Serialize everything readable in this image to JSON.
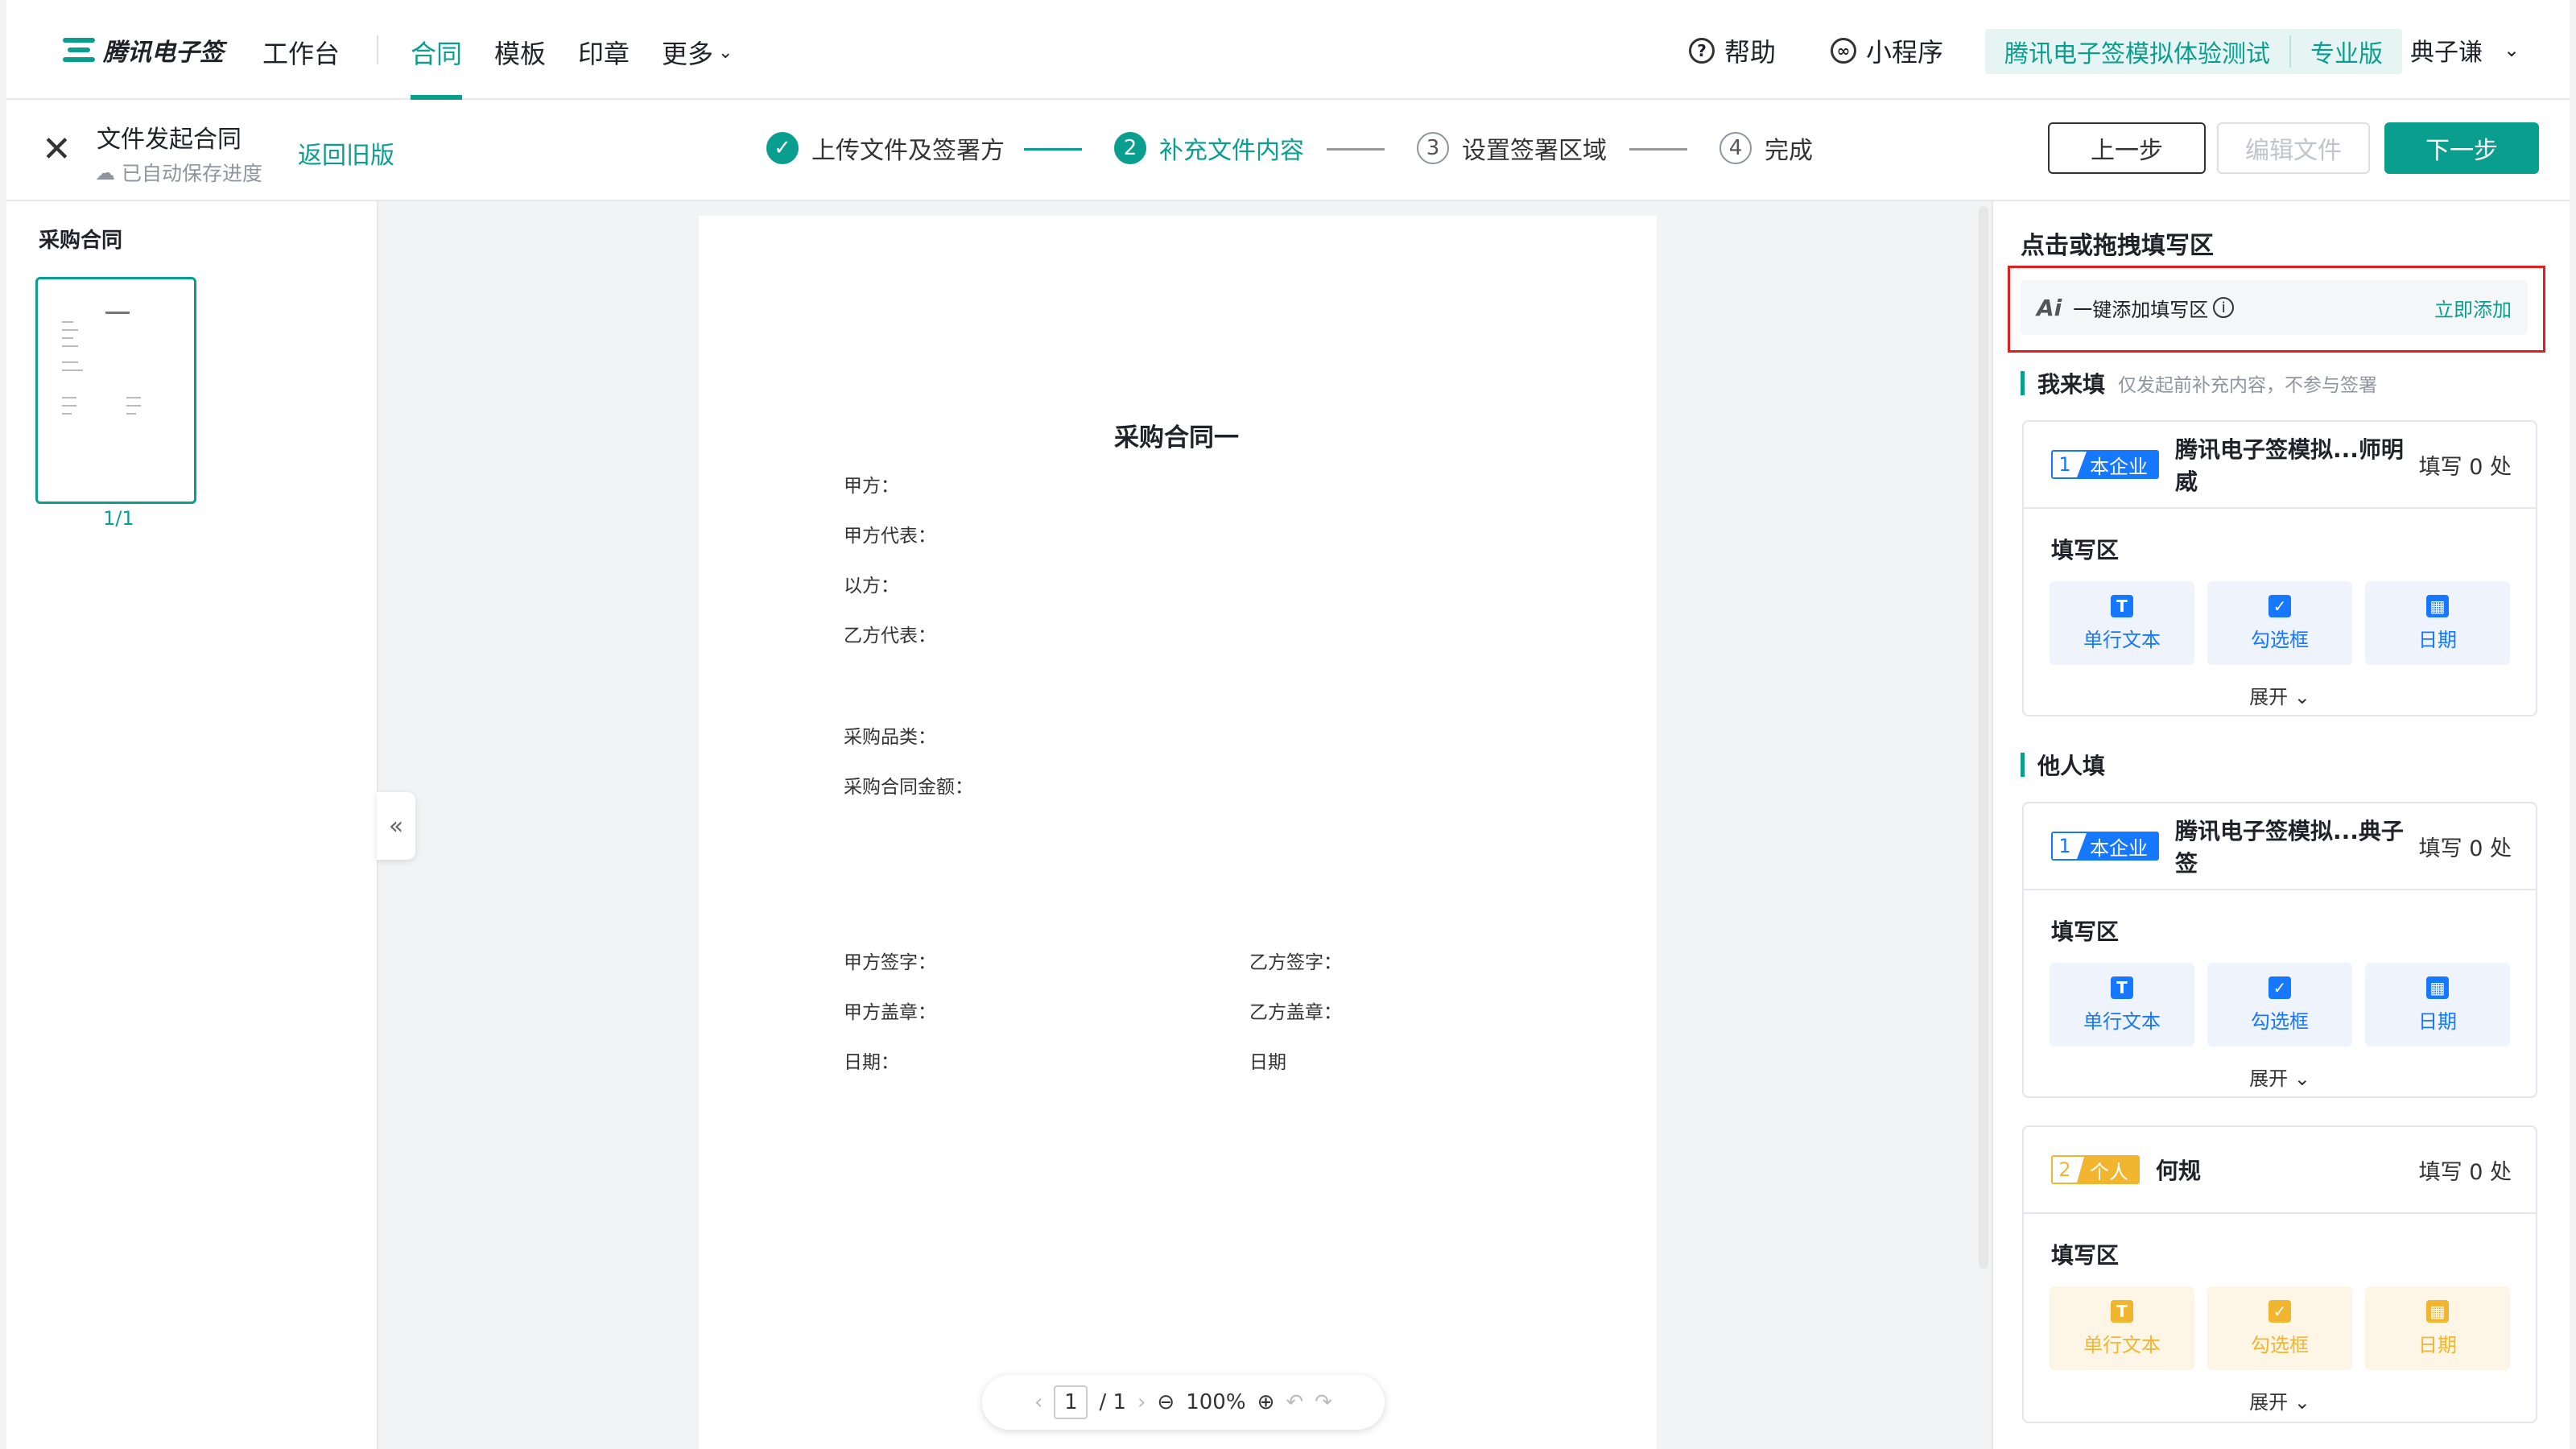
{
  "app": {
    "logo_text": "腾讯电子签"
  },
  "nav": {
    "items": [
      "工作台",
      "合同",
      "模板",
      "印章",
      "更多"
    ],
    "help": "帮助",
    "miniapp": "小程序",
    "org_name": "腾讯电子签模拟体验测试",
    "org_plan": "专业版",
    "user": "典子谦"
  },
  "subbar": {
    "title": "文件发起合同",
    "autosave": "已自动保存进度",
    "back_old": "返回旧版",
    "steps": [
      {
        "num": "✓",
        "label": "上传文件及签署方"
      },
      {
        "num": "2",
        "label": "补充文件内容"
      },
      {
        "num": "3",
        "label": "设置签署区域"
      },
      {
        "num": "4",
        "label": "完成"
      }
    ],
    "btn_prev": "上一步",
    "btn_edit": "编辑文件",
    "btn_next": "下一步"
  },
  "left": {
    "title": "采购合同",
    "page_label": "1/1"
  },
  "doc": {
    "heading": "采购合同一",
    "lines": [
      "甲方：",
      "甲方代表：",
      "以方：",
      "乙方代表：",
      "采购品类：",
      "采购合同金额："
    ],
    "sign_left": [
      "甲方签字：",
      "甲方盖章：",
      "日期："
    ],
    "sign_right": [
      "乙方签字：",
      "乙方盖章：",
      "日期"
    ]
  },
  "toolbar": {
    "page_current": "1",
    "page_total": "/ 1",
    "zoom": "100%"
  },
  "right": {
    "title": "点击或拖拽填写区",
    "ai_logo": "Ai",
    "ai_label": "一键添加填写区",
    "ai_action": "立即添加",
    "self_section": "我来填",
    "self_note": "仅发起前补充内容，不参与签署",
    "other_section": "他人填",
    "fill_area": "填写区",
    "tiles": [
      "单行文本",
      "勾选框",
      "日期"
    ],
    "expand": "展开",
    "cards": [
      {
        "num": "1",
        "tag": "本企业",
        "name": "腾讯电子签模拟...师明威",
        "count": "填写 0 处"
      },
      {
        "num": "1",
        "tag": "本企业",
        "name": "腾讯电子签模拟...典子签",
        "count": "填写 0 处"
      },
      {
        "num": "2",
        "tag": "个人",
        "name": "何规",
        "count": "填写 0 处"
      }
    ]
  }
}
